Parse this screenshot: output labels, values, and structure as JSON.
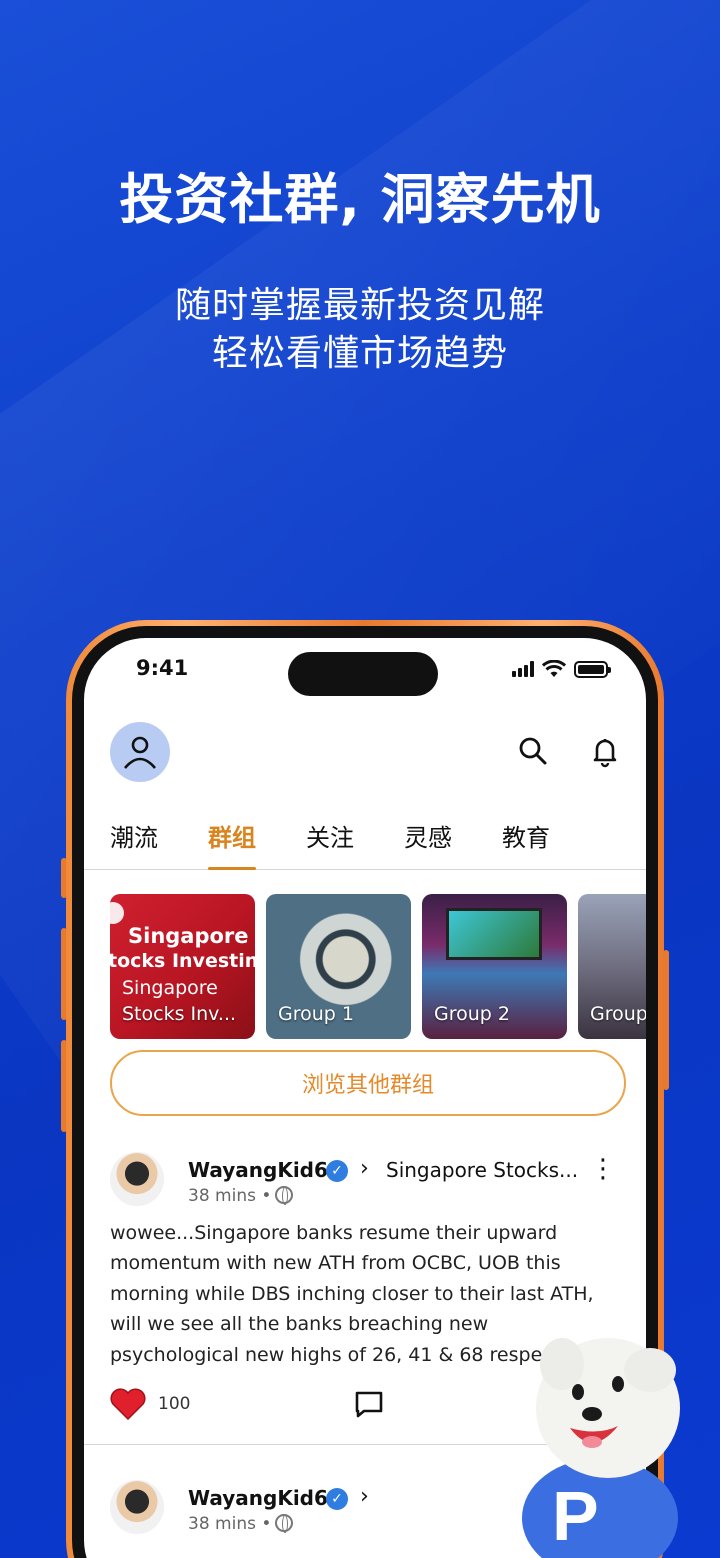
{
  "promo": {
    "headline": "投资社群, 洞察先机",
    "subline_1": "随时掌握最新投资见解",
    "subline_2": "轻松看懂市场趋势"
  },
  "status_bar": {
    "time": "9:41"
  },
  "header": {
    "avatar_icon": "user-icon",
    "search_icon": "search-icon",
    "bell_icon": "bell-icon"
  },
  "tabs": [
    {
      "label": "潮流",
      "active": false
    },
    {
      "label": "群组",
      "active": true
    },
    {
      "label": "关注",
      "active": false
    },
    {
      "label": "灵感",
      "active": false
    },
    {
      "label": "教育",
      "active": false
    }
  ],
  "groups": [
    {
      "banner_line_1": "Singapore",
      "banner_line_2": "tocks Investin",
      "label_1": "Singapore",
      "label_2": "Stocks Inv..."
    },
    {
      "label": "Group 1"
    },
    {
      "label": "Group 2"
    },
    {
      "label": "Group"
    }
  ],
  "browse_button": "浏览其他群组",
  "posts": [
    {
      "user": "WayangKid66",
      "group": "Singapore Stocks...",
      "time": "38 mins",
      "text": "wowee...Singapore banks resume their upward momentum with new ATH from OCBC, UOB this morning while DBS inching closer to their last ATH, will we see all the banks breaching new psychological new highs of 26, 41 & 68 respect",
      "likes": "100"
    },
    {
      "user": "WayangKid66",
      "time": "38 mins"
    }
  ],
  "colors": {
    "brand_blue": "#0e3fcb",
    "accent_orange": "#d9851f",
    "verified_blue": "#2f7de1",
    "heart_red": "#e0202c"
  }
}
